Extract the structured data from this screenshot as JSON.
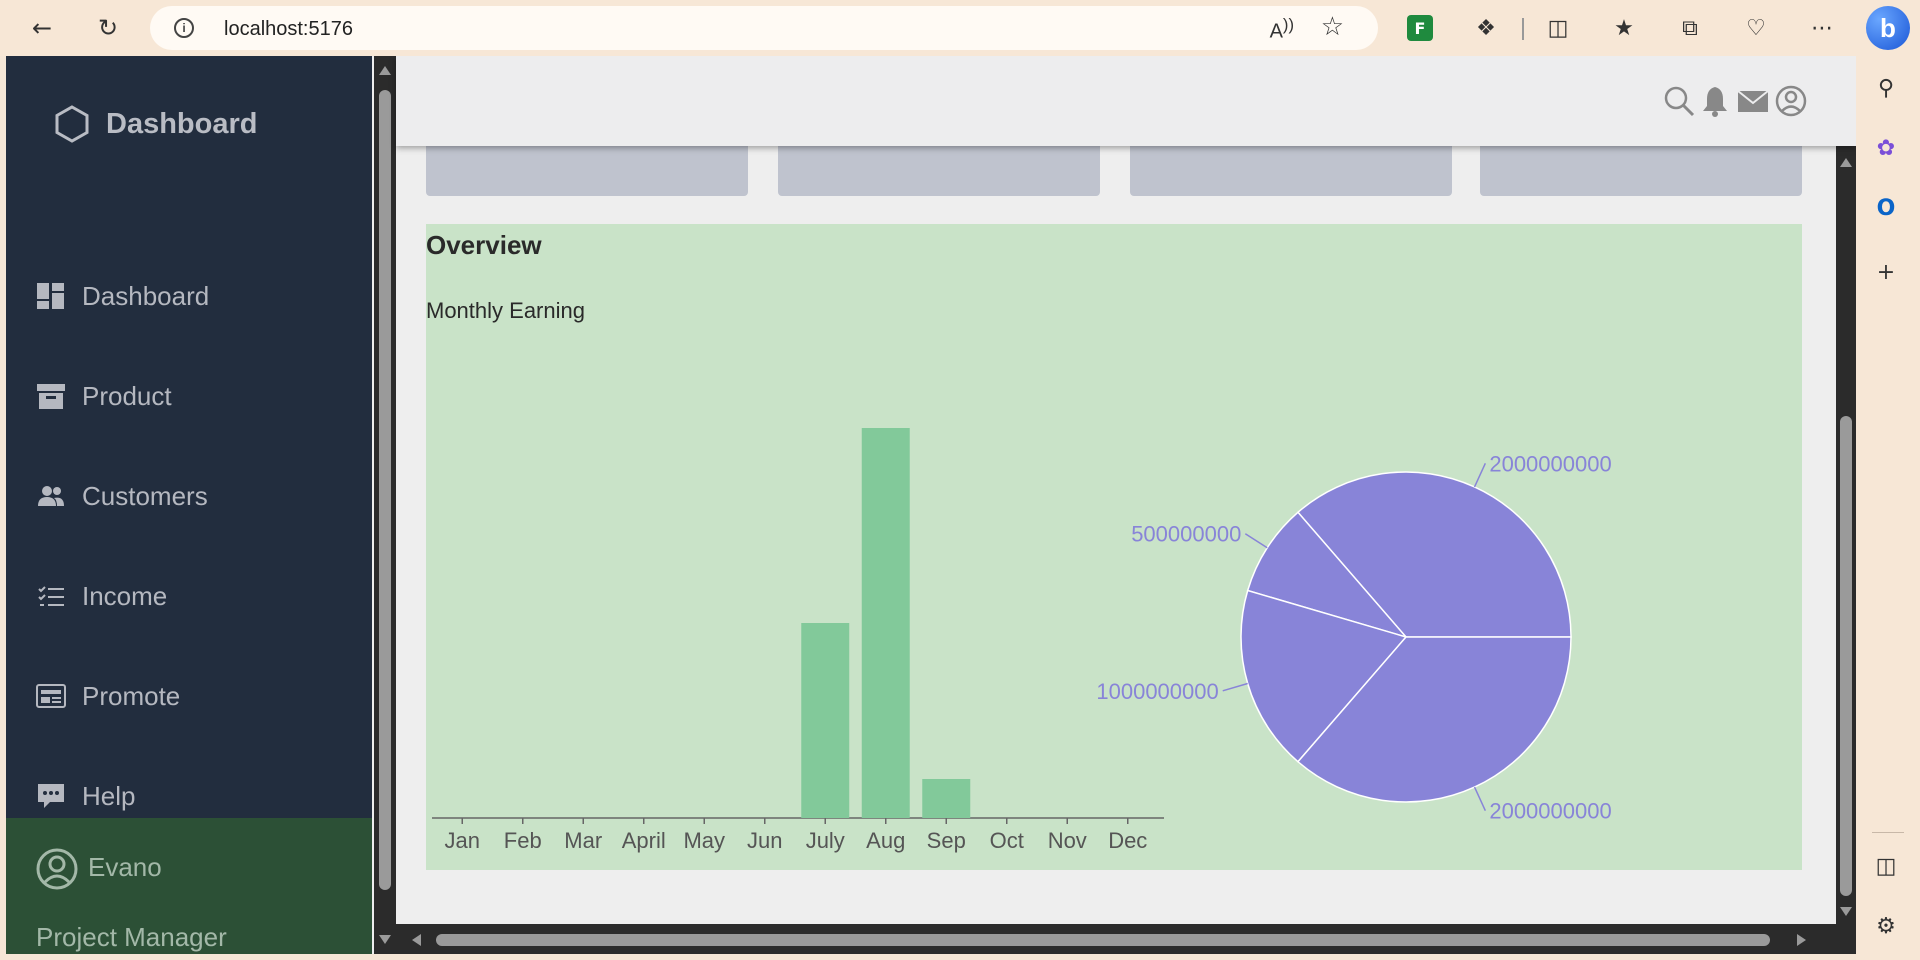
{
  "browser": {
    "url": "localhost:5176"
  },
  "sidebar": {
    "brand": "Dashboard",
    "items": [
      {
        "label": "Dashboard",
        "icon": "dashboard-icon"
      },
      {
        "label": "Product",
        "icon": "archive-icon"
      },
      {
        "label": "Customers",
        "icon": "users-icon"
      },
      {
        "label": "Income",
        "icon": "list-icon"
      },
      {
        "label": "Promote",
        "icon": "newspaper-icon"
      },
      {
        "label": "Help",
        "icon": "chat-icon"
      }
    ],
    "profile": {
      "name": "Evano",
      "role": "Project Manager"
    }
  },
  "header": {
    "icons": [
      "search-icon",
      "bell-icon",
      "mail-icon",
      "user-icon"
    ]
  },
  "overview": {
    "title": "Overview",
    "subtitle": "Monthly Earning"
  },
  "colors": {
    "bar": "#82c99a",
    "pie": "#8884d8",
    "sidebar": "#222d3e",
    "overview_bg": "#c9e3c8"
  },
  "chart_data": [
    {
      "type": "bar",
      "categories": [
        "Jan",
        "Feb",
        "Mar",
        "April",
        "May",
        "Jun",
        "July",
        "Aug",
        "Sep",
        "Oct",
        "Nov",
        "Dec"
      ],
      "values": [
        0,
        0,
        0,
        0,
        0,
        0,
        1000000000,
        2000000000,
        200000000,
        0,
        0,
        0
      ],
      "ylim": [
        0,
        2000000000
      ],
      "title": "",
      "xlabel": "",
      "ylabel": "",
      "grid": false
    },
    {
      "type": "pie",
      "values": [
        2000000000,
        500000000,
        1000000000,
        2000000000
      ],
      "labels": [
        "2000000000",
        "500000000",
        "1000000000",
        "2000000000"
      ]
    }
  ]
}
